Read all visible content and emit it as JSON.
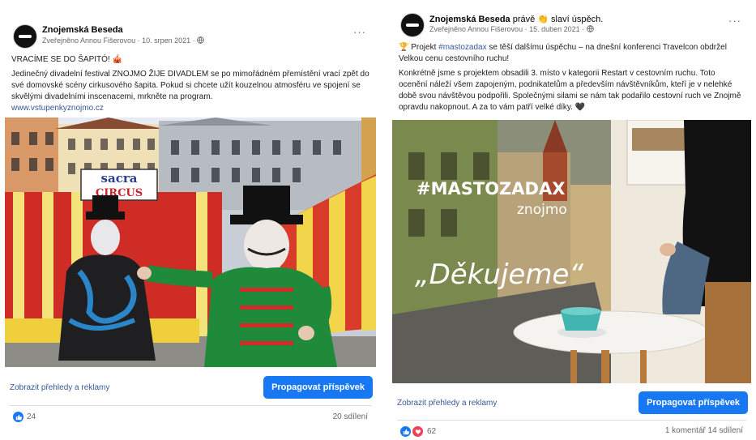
{
  "post1": {
    "page_name": "Znojemská Beseda",
    "meta": "Zveřejněno Annou Fišerovou · 10. srpen 2021 ·",
    "more": "···",
    "headline": "VRACÍME SE DO ŠAPITÓ! 🎪",
    "text": "Jedinečný divadelní festival ZNOJMO ŽIJE DIVADLEM se po mimořádném přemístění vrací zpět do své domovské scény cirkusového šapita. Pokud si chcete užít kouzelnou atmosféru ve spojení se skvělými divadelními inscenacemi, mrkněte na program.",
    "link": "www.vstupenkyznojmo.cz",
    "photo": {
      "sign_line1": "sacra",
      "sign_line2": "CIRCUS"
    },
    "insights": "Zobrazit přehledy a reklamy",
    "promote": "Propagovat příspěvek",
    "reaction_count": "24",
    "shares": "20 sdílení"
  },
  "post2": {
    "page_name": "Znojemská Beseda",
    "name_suffix": "právě 👏 slaví úspěch.",
    "meta": "Zveřejněno Annou Fišerovou · 15. duben 2021 ·",
    "more": "···",
    "p1_prefix": "🏆 Projekt ",
    "p1_hashtag": "#mastozadax",
    "p1_rest": " se těší dalšímu úspěchu – na dnešní konferenci Travelcon obdržel Velkou cenu cestovního ruchu!",
    "p2": "Konkrétně jsme s projektem obsadili 3. místo v kategorii Restart v cestovním ruchu. Toto ocenění náleží všem zapojeným, podnikatelům a především návštěvníkům, kteří je v nelehké době svou návštěvou podpořili. Společnými silami se nám tak podařilo cestovní ruch ve Znojmě opravdu nakopnout. A za to vám patří velké díky. 🖤",
    "photo": {
      "hashtag": "#MASTOZADAX",
      "brand": "znojmo",
      "thanks": "„Děkujeme“"
    },
    "insights": "Zobrazit přehledy a reklamy",
    "promote": "Propagovat příspěvek",
    "reaction_count": "62",
    "comments": "1 komentář",
    "shares": "14 sdílení"
  },
  "colors": {
    "accent": "#1877f2",
    "link": "#385898",
    "muted": "#65676b"
  },
  "icons": [
    "globe-icon",
    "like-icon",
    "love-icon",
    "more-icon"
  ]
}
